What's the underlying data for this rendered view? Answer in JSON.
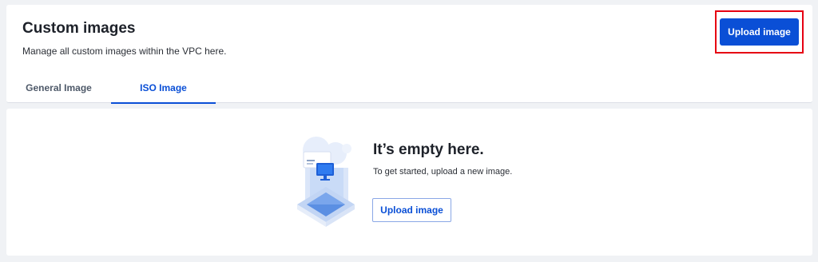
{
  "header": {
    "title": "Custom images",
    "subtitle": "Manage all custom images within the VPC here.",
    "upload_label": "Upload image"
  },
  "tabs": [
    {
      "label": "General Image",
      "active": false
    },
    {
      "label": "ISO Image",
      "active": true
    }
  ],
  "empty_state": {
    "title": "It’s empty here.",
    "description": "To get started, upload a new image.",
    "button_label": "Upload image",
    "illustration_icon": "empty-image-illustration-icon"
  },
  "colors": {
    "accent": "#0a4fd6",
    "highlight": "#e60012",
    "background": "#f0f2f5"
  }
}
